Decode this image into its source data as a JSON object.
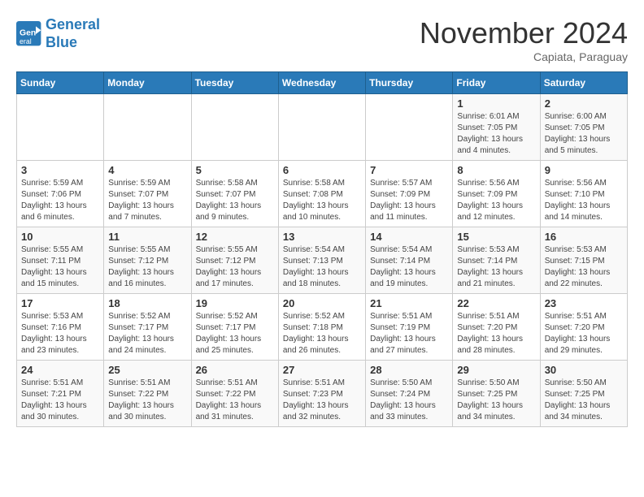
{
  "header": {
    "logo_line1": "General",
    "logo_line2": "Blue",
    "month": "November 2024",
    "location": "Capiata, Paraguay"
  },
  "weekdays": [
    "Sunday",
    "Monday",
    "Tuesday",
    "Wednesday",
    "Thursday",
    "Friday",
    "Saturday"
  ],
  "weeks": [
    [
      {
        "day": "",
        "info": ""
      },
      {
        "day": "",
        "info": ""
      },
      {
        "day": "",
        "info": ""
      },
      {
        "day": "",
        "info": ""
      },
      {
        "day": "",
        "info": ""
      },
      {
        "day": "1",
        "info": "Sunrise: 6:01 AM\nSunset: 7:05 PM\nDaylight: 13 hours and 4 minutes."
      },
      {
        "day": "2",
        "info": "Sunrise: 6:00 AM\nSunset: 7:05 PM\nDaylight: 13 hours and 5 minutes."
      }
    ],
    [
      {
        "day": "3",
        "info": "Sunrise: 5:59 AM\nSunset: 7:06 PM\nDaylight: 13 hours and 6 minutes."
      },
      {
        "day": "4",
        "info": "Sunrise: 5:59 AM\nSunset: 7:07 PM\nDaylight: 13 hours and 7 minutes."
      },
      {
        "day": "5",
        "info": "Sunrise: 5:58 AM\nSunset: 7:07 PM\nDaylight: 13 hours and 9 minutes."
      },
      {
        "day": "6",
        "info": "Sunrise: 5:58 AM\nSunset: 7:08 PM\nDaylight: 13 hours and 10 minutes."
      },
      {
        "day": "7",
        "info": "Sunrise: 5:57 AM\nSunset: 7:09 PM\nDaylight: 13 hours and 11 minutes."
      },
      {
        "day": "8",
        "info": "Sunrise: 5:56 AM\nSunset: 7:09 PM\nDaylight: 13 hours and 12 minutes."
      },
      {
        "day": "9",
        "info": "Sunrise: 5:56 AM\nSunset: 7:10 PM\nDaylight: 13 hours and 14 minutes."
      }
    ],
    [
      {
        "day": "10",
        "info": "Sunrise: 5:55 AM\nSunset: 7:11 PM\nDaylight: 13 hours and 15 minutes."
      },
      {
        "day": "11",
        "info": "Sunrise: 5:55 AM\nSunset: 7:12 PM\nDaylight: 13 hours and 16 minutes."
      },
      {
        "day": "12",
        "info": "Sunrise: 5:55 AM\nSunset: 7:12 PM\nDaylight: 13 hours and 17 minutes."
      },
      {
        "day": "13",
        "info": "Sunrise: 5:54 AM\nSunset: 7:13 PM\nDaylight: 13 hours and 18 minutes."
      },
      {
        "day": "14",
        "info": "Sunrise: 5:54 AM\nSunset: 7:14 PM\nDaylight: 13 hours and 19 minutes."
      },
      {
        "day": "15",
        "info": "Sunrise: 5:53 AM\nSunset: 7:14 PM\nDaylight: 13 hours and 21 minutes."
      },
      {
        "day": "16",
        "info": "Sunrise: 5:53 AM\nSunset: 7:15 PM\nDaylight: 13 hours and 22 minutes."
      }
    ],
    [
      {
        "day": "17",
        "info": "Sunrise: 5:53 AM\nSunset: 7:16 PM\nDaylight: 13 hours and 23 minutes."
      },
      {
        "day": "18",
        "info": "Sunrise: 5:52 AM\nSunset: 7:17 PM\nDaylight: 13 hours and 24 minutes."
      },
      {
        "day": "19",
        "info": "Sunrise: 5:52 AM\nSunset: 7:17 PM\nDaylight: 13 hours and 25 minutes."
      },
      {
        "day": "20",
        "info": "Sunrise: 5:52 AM\nSunset: 7:18 PM\nDaylight: 13 hours and 26 minutes."
      },
      {
        "day": "21",
        "info": "Sunrise: 5:51 AM\nSunset: 7:19 PM\nDaylight: 13 hours and 27 minutes."
      },
      {
        "day": "22",
        "info": "Sunrise: 5:51 AM\nSunset: 7:20 PM\nDaylight: 13 hours and 28 minutes."
      },
      {
        "day": "23",
        "info": "Sunrise: 5:51 AM\nSunset: 7:20 PM\nDaylight: 13 hours and 29 minutes."
      }
    ],
    [
      {
        "day": "24",
        "info": "Sunrise: 5:51 AM\nSunset: 7:21 PM\nDaylight: 13 hours and 30 minutes."
      },
      {
        "day": "25",
        "info": "Sunrise: 5:51 AM\nSunset: 7:22 PM\nDaylight: 13 hours and 30 minutes."
      },
      {
        "day": "26",
        "info": "Sunrise: 5:51 AM\nSunset: 7:22 PM\nDaylight: 13 hours and 31 minutes."
      },
      {
        "day": "27",
        "info": "Sunrise: 5:51 AM\nSunset: 7:23 PM\nDaylight: 13 hours and 32 minutes."
      },
      {
        "day": "28",
        "info": "Sunrise: 5:50 AM\nSunset: 7:24 PM\nDaylight: 13 hours and 33 minutes."
      },
      {
        "day": "29",
        "info": "Sunrise: 5:50 AM\nSunset: 7:25 PM\nDaylight: 13 hours and 34 minutes."
      },
      {
        "day": "30",
        "info": "Sunrise: 5:50 AM\nSunset: 7:25 PM\nDaylight: 13 hours and 34 minutes."
      }
    ]
  ]
}
